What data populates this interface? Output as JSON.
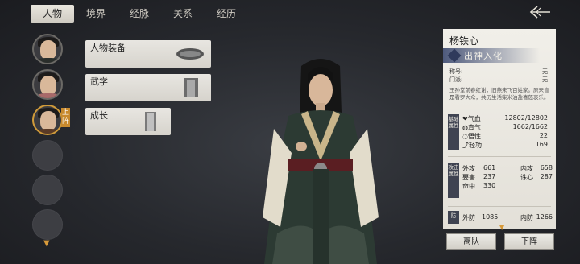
{
  "tabs": [
    "人物",
    "境界",
    "经脉",
    "关系",
    "经历"
  ],
  "active_tab": "人物",
  "back_icon": "back-arrow-icon",
  "avatar_badge": "上阵",
  "menu": {
    "equipment": "人物装备",
    "martial": "武学",
    "growth": "成长"
  },
  "character": {
    "name": "杨铁心",
    "rank": "出神入化",
    "title_label": "称号:",
    "title_value": "无",
    "sect_label": "门派:",
    "sect_value": "无",
    "description": "王孙堂前春红谢，旧燕未飞百姓家。原来皆是看罗大众，共历生活柴米油盐喜怒哀乐。"
  },
  "basic_attrs": {
    "section_label": "基础属性",
    "qixue_label": "气血",
    "qixue_value": "12802/12802",
    "zhenqi_label": "真气",
    "zhenqi_value": "1662/1662",
    "wuxing_label": "悟性",
    "wuxing_value": "22",
    "qinggong_label": "轻功",
    "qinggong_value": "169"
  },
  "attack_attrs": {
    "section_label": "攻击属性",
    "waigong_label": "外攻",
    "waigong_value": "661",
    "neigong_label": "内攻",
    "neigong_value": "658",
    "yaohai_label": "要害",
    "yaohai_value": "237",
    "zhuxin_label": "诛心",
    "zhuxin_value": "287",
    "mingzhong_label": "命中",
    "mingzhong_value": "330"
  },
  "defense_attrs": {
    "section_label": "防",
    "waifang_label": "外防",
    "waifang_value": "1085",
    "neifang_label": "内防",
    "neifang_value": "1266"
  },
  "buttons": {
    "leave": "离队",
    "down": "下阵"
  }
}
